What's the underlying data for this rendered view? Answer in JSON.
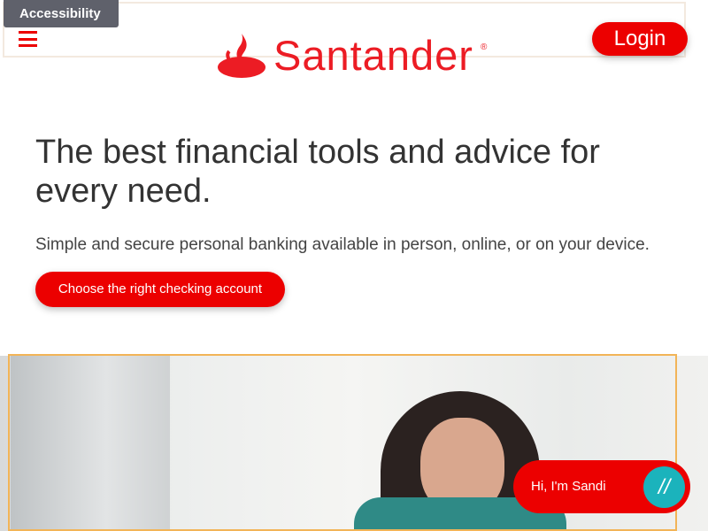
{
  "header": {
    "accessibility_label": "Accessibility",
    "login_label": "Login",
    "logo_text": "Santander",
    "logo_mark": "®"
  },
  "hero": {
    "headline": "The best financial tools and advice for every need.",
    "subtext": "Simple and secure personal banking available in person, online, or on your device.",
    "cta_label": "Choose the right checking account"
  },
  "chat": {
    "label": "Hi, I'm Sandi"
  },
  "colors": {
    "brand": "#ec0000",
    "chat_icon": "#1bb3bc"
  }
}
